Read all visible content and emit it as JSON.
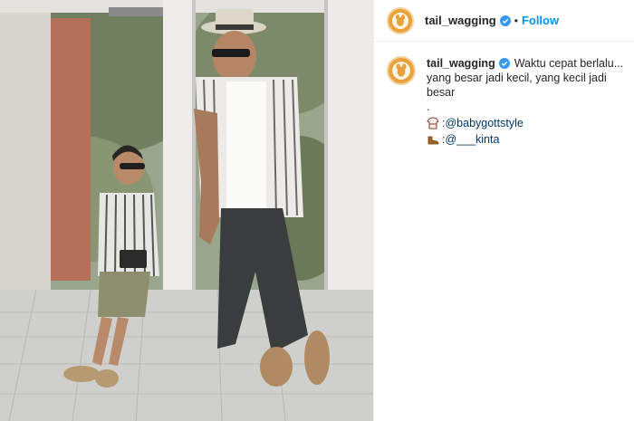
{
  "header": {
    "username": "tail_wagging",
    "separator": "•",
    "follow_label": "Follow",
    "verified_icon": "verified-badge-icon",
    "accent_color": "#0095f6"
  },
  "caption": {
    "username": "tail_wagging",
    "first_line": "Waktu cepat berlalu...",
    "line2": "yang besar jadi kecil, yang kecil jadi",
    "line3": "besar",
    "dot_line": ".",
    "credits": [
      {
        "icon": "shirt-icon",
        "prefix": ": ",
        "mention": "@babygottstyle"
      },
      {
        "icon": "shoe-icon",
        "prefix": ": ",
        "mention": "@___kinta"
      }
    ]
  }
}
